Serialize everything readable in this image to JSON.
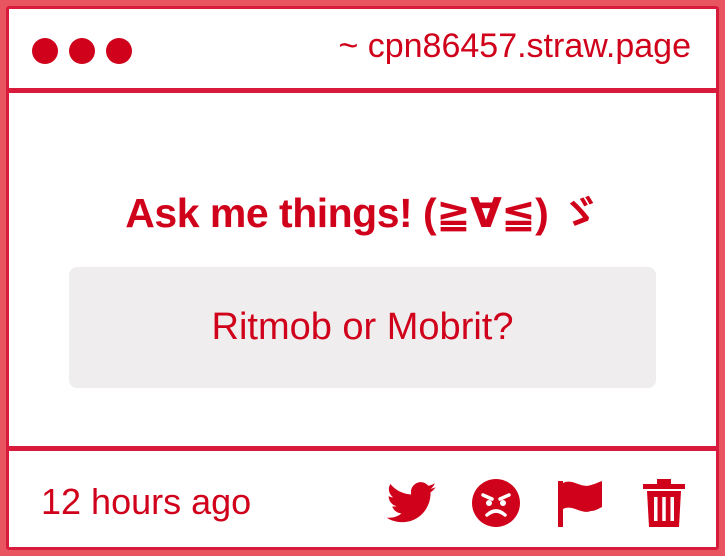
{
  "window": {
    "url": "~ cpn86457.straw.page"
  },
  "main": {
    "heading": "Ask me things!  (≧∀≦) ゞ",
    "question": "Ritmob or Mobrit?"
  },
  "footer": {
    "timestamp": "12 hours ago",
    "actions": [
      {
        "icon": "twitter-icon"
      },
      {
        "icon": "angry-face-icon"
      },
      {
        "icon": "flag-icon"
      },
      {
        "icon": "trash-icon"
      }
    ]
  },
  "colors": {
    "accent": "#d0021b",
    "border": "#d81b3c",
    "background": "#e8545f",
    "question_bg": "#efedee"
  }
}
